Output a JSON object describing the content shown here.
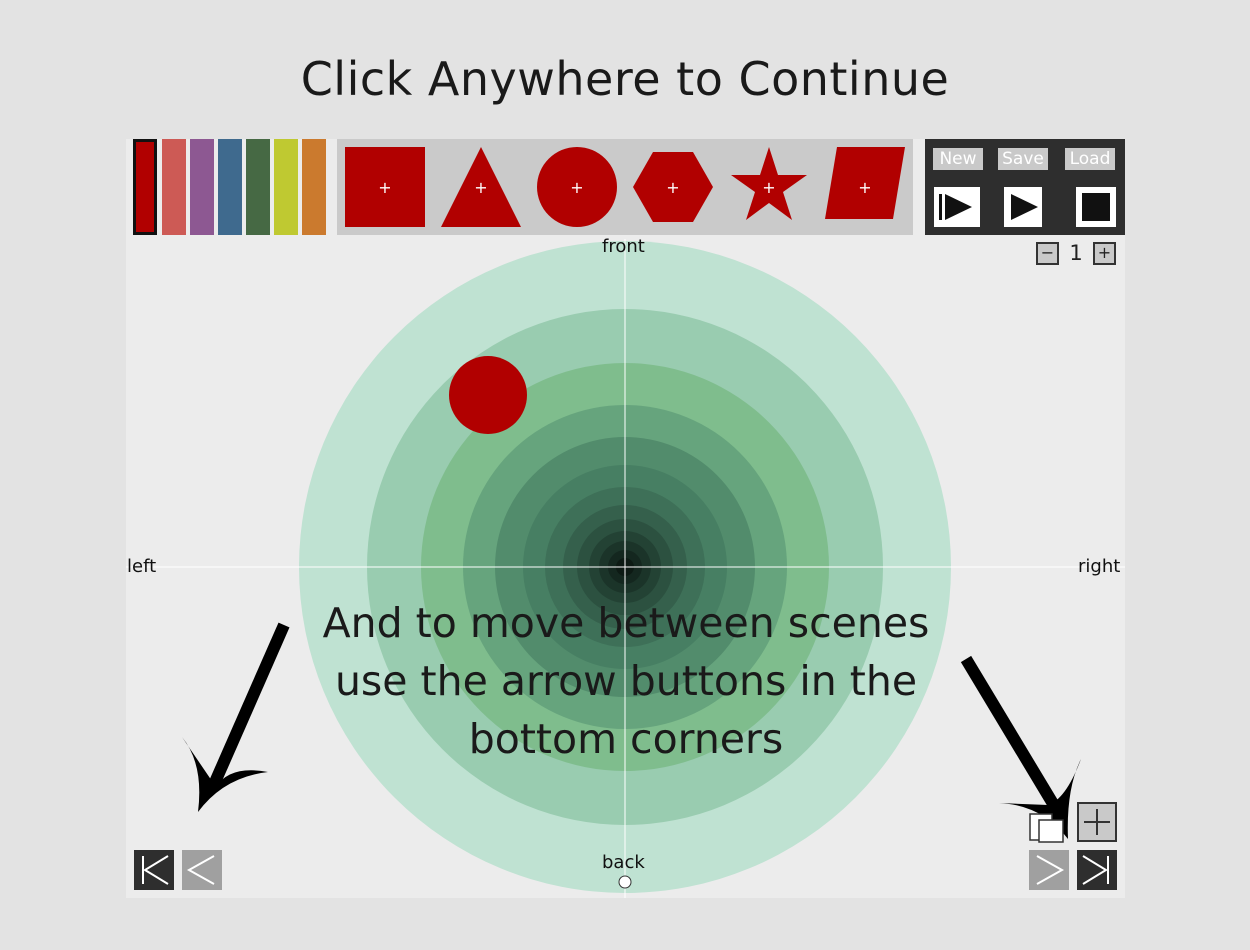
{
  "overlay": {
    "title": "Click Anywhere to Continue",
    "instruction_lines": [
      "And to move between scenes",
      "use the arrow buttons in the",
      "bottom corners"
    ]
  },
  "palette": {
    "colors": [
      "#b10000",
      "#cd5a55",
      "#8d5892",
      "#3f6a8e",
      "#466944",
      "#bfc931",
      "#cb7a2e"
    ],
    "selected_index": 0
  },
  "shapes": {
    "fill_color": "#b10000",
    "items": [
      "square",
      "triangle",
      "circle",
      "hexagon",
      "star",
      "parallelogram"
    ],
    "add_glyph": "+"
  },
  "controls": {
    "new_label": "New",
    "save_label": "Save",
    "load_label": "Load",
    "play_from_start_icon": "play-from-start-icon",
    "play_icon": "play-icon",
    "stop_icon": "stop-icon"
  },
  "counter": {
    "minus": "−",
    "value": "1",
    "plus": "+"
  },
  "scene": {
    "front_label": "front",
    "back_label": "back",
    "left_label": "left",
    "right_label": "right",
    "placed_object": {
      "shape": "circle",
      "color": "#b10000"
    }
  },
  "navigation": {
    "first_scene_icon": "first-scene-icon",
    "prev_scene_icon": "prev-scene-icon",
    "next_scene_icon": "next-scene-icon",
    "last_scene_icon": "last-scene-icon",
    "duplicate_scene_icon": "duplicate-scene-icon",
    "add_scene_icon": "add-scene-icon"
  },
  "colors": {
    "ring_light": "#bfe2d2",
    "ring_dark": "#111f18",
    "accent_red": "#b10000",
    "panel_dark": "#2e2e2e",
    "button_gray": "#a0a0a0"
  }
}
